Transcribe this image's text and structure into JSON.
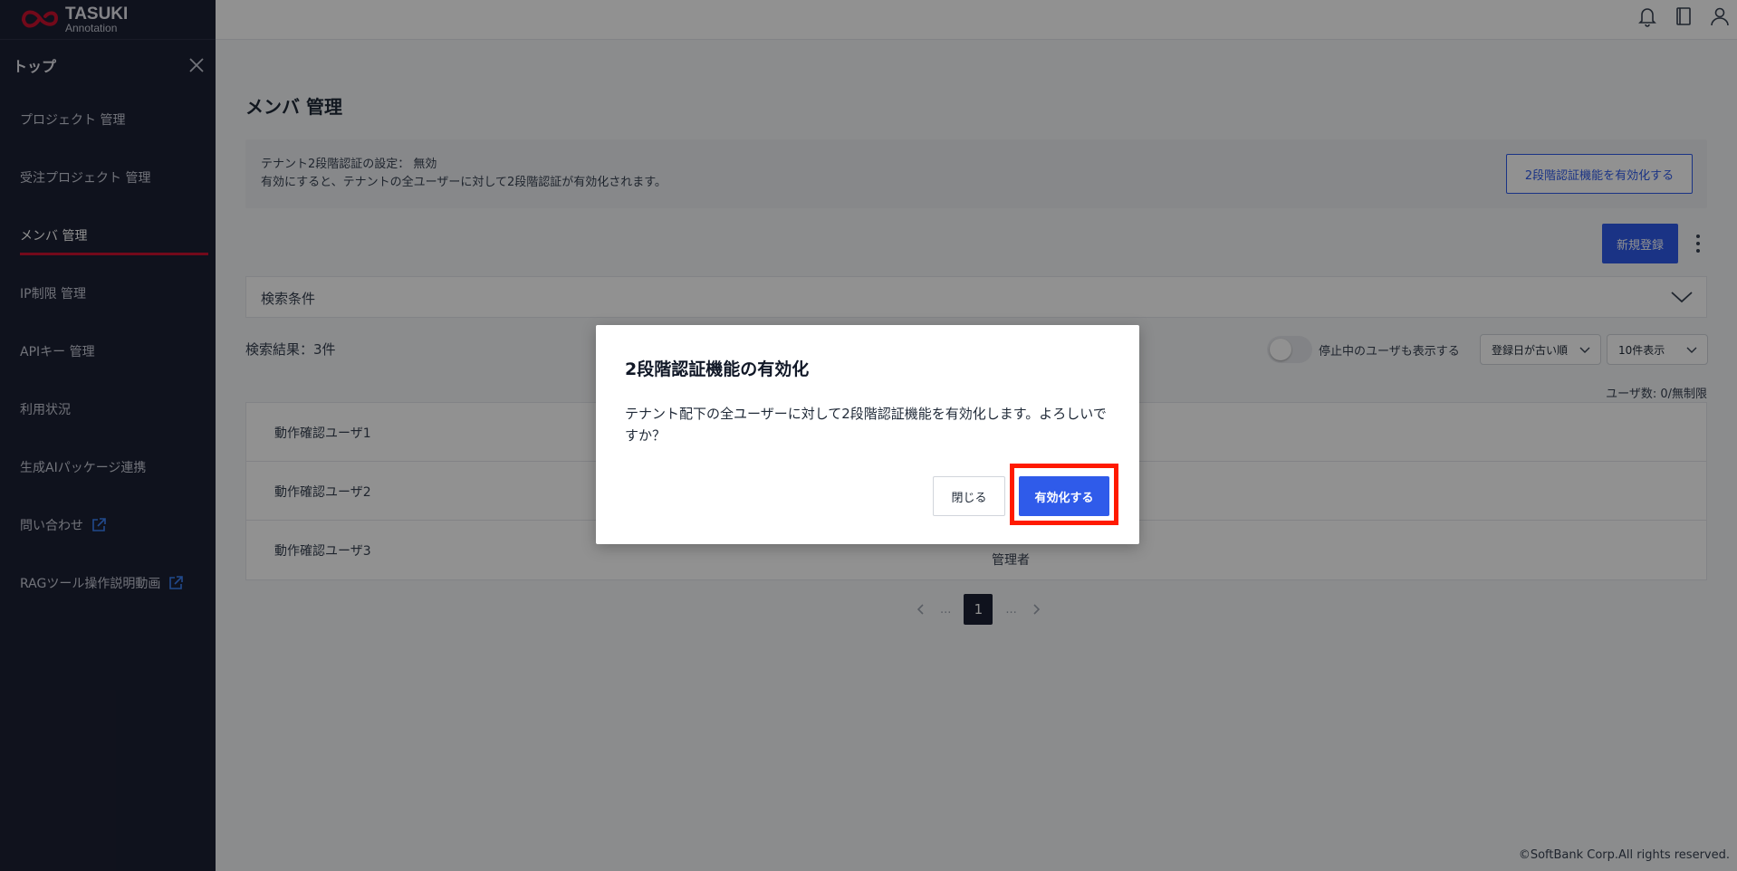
{
  "app": {
    "logo_title": "TASUKI",
    "logo_subtitle": "Annotation",
    "brand_color": "#c8102e"
  },
  "sidebar": {
    "top_label": "トップ",
    "items": [
      {
        "label": "プロジェクト 管理",
        "active": false
      },
      {
        "label": "受注プロジェクト 管理",
        "active": false
      },
      {
        "label": "メンバ 管理",
        "active": true
      },
      {
        "label": "IP制限 管理",
        "active": false
      },
      {
        "label": "APIキー 管理",
        "active": false
      },
      {
        "label": "利用状況",
        "active": false
      },
      {
        "label": "生成AIパッケージ連携",
        "active": false
      },
      {
        "label": "問い合わせ",
        "active": false,
        "external": true
      },
      {
        "label": "RAGツール操作説明動画",
        "active": false,
        "external": true
      }
    ]
  },
  "topbar": {
    "icons": [
      "bell-icon",
      "book-icon",
      "user-icon"
    ]
  },
  "main": {
    "title": "メンバ 管理",
    "mfa": {
      "setting_text": "テナント2段階認証の設定： 無効",
      "description": "有効にすると、テナントの全ユーザーに対して2段階認証が有効化されます。",
      "enable_button": "2段階認証機能を有効化する"
    },
    "new_button": "新規登録",
    "search": {
      "label": "検索条件"
    },
    "results_text": "検索結果：3件",
    "show_stopped_label": "停止中のユーザも表示する",
    "sort_select": "登録日が古い順",
    "per_page_select": "10件表示",
    "user_count": "ユーザ数: 0/無制限",
    "users": [
      {
        "name": "動作確認ユーザ1",
        "role": ""
      },
      {
        "name": "動作確認ユーザ2",
        "role": ""
      },
      {
        "name": "動作確認ユーザ3",
        "role": "管理者"
      }
    ],
    "pagination": {
      "prev_dots": "...",
      "current_page": "1",
      "next_dots": "..."
    },
    "footer": "©SoftBank Corp.All rights reserved."
  },
  "modal": {
    "title": "2段階認証機能の有効化",
    "message": "テナント配下の全ユーザーに対して2段階認証機能を有効化します。よろしいですか？",
    "close_button": "閉じる",
    "confirm_button": "有効化する",
    "highlight_color": "#ff1a00"
  }
}
